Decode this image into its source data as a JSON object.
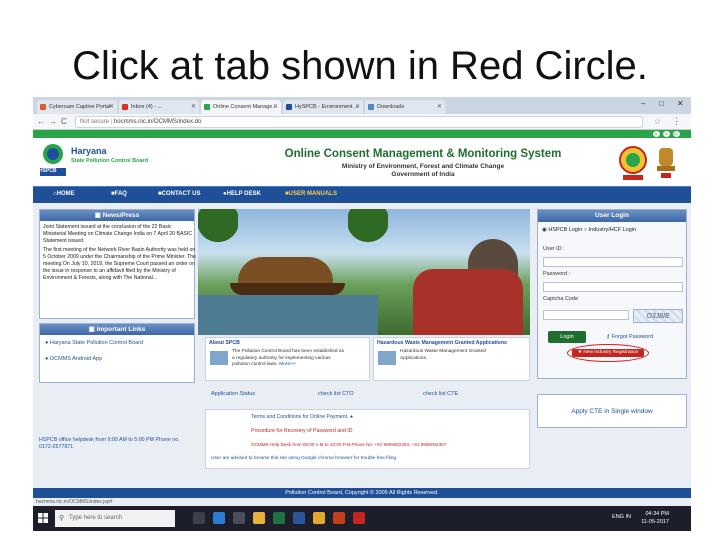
{
  "slide": {
    "title": "Click at tab shown in Red Circle."
  },
  "browser": {
    "tabs": [
      {
        "label": "Cyberoam Captive Portal",
        "fav": "#e05a2b"
      },
      {
        "label": "Inbox (4) - ...",
        "fav": "#d93025"
      },
      {
        "label": "Online Consent Manage...",
        "fav": "#2aa449"
      },
      {
        "label": "HySPCB - Environment ...",
        "fav": "#1f4e9c"
      },
      {
        "label": "Downloads",
        "fav": "#4a86c8"
      }
    ],
    "url_prefix": "Not secure",
    "url": "hocmms.nic.in/OCMMS/index.do",
    "win_min": "–",
    "win_max": "□",
    "win_close": "✕",
    "back": "←",
    "forward": "→",
    "reload": "C"
  },
  "site": {
    "brand_name": "Haryana",
    "brand_sub": "State Pollution Control Board",
    "brand_abbr": "HSPCB",
    "title": "Online Consent Management & Monitoring System",
    "subtitle1": "Ministry of Environment, Forest and Climate Change",
    "subtitle2": "Government of India",
    "access": [
      "A-",
      "A",
      "A+"
    ]
  },
  "nav": {
    "home": "HOME",
    "faq": "FAQ",
    "contact": "CONTACT US",
    "helpdesk": "HELP DESK",
    "manuals": "USER MANUALS"
  },
  "news": {
    "heading": "News/Press",
    "items": [
      "Joint Statement issued at the conclusion of the 22 Basic Ministerial Meeting on Climate Change India on 7 April 20 BASIC Statement issued.",
      "The first meeting of the Network River Basin Authority was held on 5 October 2009 under the Chairmanship of the Prime Minister. The meeting On July 10, 2019, the Supreme Court passed an order on the issue in response to an affidavit filed by the Ministry of Environment & Forests, along with The National..."
    ]
  },
  "links": {
    "heading": "Important Links",
    "items": [
      "Haryana State Pollution Control Board",
      "OCMMS Android App"
    ]
  },
  "about": {
    "title": "About SPCB",
    "text1": "The Pollution Control Board has been established as",
    "text2": "a regulatory authority for implementing various",
    "text3": "pollution control laws.",
    "more": "More>>"
  },
  "hazard": {
    "title": "Hazardous Waste Management Granted Applications",
    "text1": "Hazardous    Waste    Management    Granted",
    "text2": "Applications."
  },
  "quick": {
    "status": "Application Status",
    "check_cto": "check list CTO",
    "check_cte": "check list CTE"
  },
  "notice": {
    "terms": "Terms and Conditions for Online Payment.",
    "recovery": "Procedure for Recovery of Password and ID",
    "helpdesk": "OCMMS Help Desk from 09:00 A.M to 10:00 P.M,Phone No: +91 9999002393, +91 9999002397",
    "browser": "User are advised to browse this site using Google chrome browser for trouble free filing."
  },
  "help": {
    "text": "HSPCB office helpdesk from 9:00 AM to 5:00 PM Phone no. 0172-2577871"
  },
  "login": {
    "heading": "User Login",
    "option1": "HSPCB Login",
    "option2": "Industry/HCF Login",
    "userid": "User ID :",
    "password": "Password :",
    "captcha_label": "Captcha Code",
    "captcha": "O3J8IE",
    "login_btn": "Login",
    "forgot": "Forgot Password",
    "register": "New Industry Registration"
  },
  "cte": {
    "label": "Apply CTE in Single window"
  },
  "footer": {
    "text": "Pollution Control Board, Copyright © 2009 All Rights Reserved.",
    "status": "hocmms.nic.in/OCMMS/index.jsp#"
  },
  "taskbar": {
    "search": "Type here to search",
    "time": "04:34 PM",
    "date": "11-05-2017",
    "lang": "ENG IN"
  },
  "colors": {
    "accent_green": "#2aa449",
    "nav_blue": "#1e4f97",
    "highlight_red": "#e21b1b"
  }
}
